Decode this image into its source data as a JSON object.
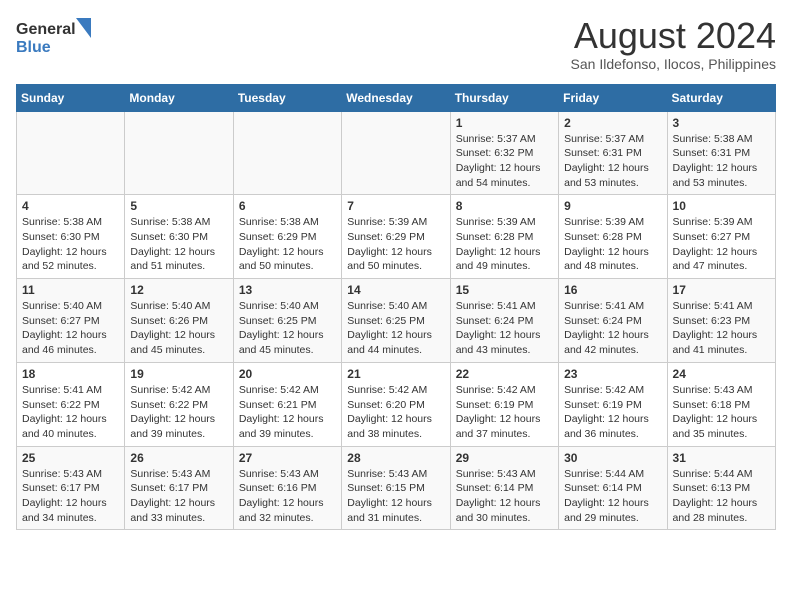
{
  "logo": {
    "text_general": "General",
    "text_blue": "Blue"
  },
  "header": {
    "title": "August 2024",
    "subtitle": "San Ildefonso, Ilocos, Philippines"
  },
  "weekdays": [
    "Sunday",
    "Monday",
    "Tuesday",
    "Wednesday",
    "Thursday",
    "Friday",
    "Saturday"
  ],
  "weeks": [
    [
      {
        "day": "",
        "info": ""
      },
      {
        "day": "",
        "info": ""
      },
      {
        "day": "",
        "info": ""
      },
      {
        "day": "",
        "info": ""
      },
      {
        "day": "1",
        "info": "Sunrise: 5:37 AM\nSunset: 6:32 PM\nDaylight: 12 hours\nand 54 minutes."
      },
      {
        "day": "2",
        "info": "Sunrise: 5:37 AM\nSunset: 6:31 PM\nDaylight: 12 hours\nand 53 minutes."
      },
      {
        "day": "3",
        "info": "Sunrise: 5:38 AM\nSunset: 6:31 PM\nDaylight: 12 hours\nand 53 minutes."
      }
    ],
    [
      {
        "day": "4",
        "info": "Sunrise: 5:38 AM\nSunset: 6:30 PM\nDaylight: 12 hours\nand 52 minutes."
      },
      {
        "day": "5",
        "info": "Sunrise: 5:38 AM\nSunset: 6:30 PM\nDaylight: 12 hours\nand 51 minutes."
      },
      {
        "day": "6",
        "info": "Sunrise: 5:38 AM\nSunset: 6:29 PM\nDaylight: 12 hours\nand 50 minutes."
      },
      {
        "day": "7",
        "info": "Sunrise: 5:39 AM\nSunset: 6:29 PM\nDaylight: 12 hours\nand 50 minutes."
      },
      {
        "day": "8",
        "info": "Sunrise: 5:39 AM\nSunset: 6:28 PM\nDaylight: 12 hours\nand 49 minutes."
      },
      {
        "day": "9",
        "info": "Sunrise: 5:39 AM\nSunset: 6:28 PM\nDaylight: 12 hours\nand 48 minutes."
      },
      {
        "day": "10",
        "info": "Sunrise: 5:39 AM\nSunset: 6:27 PM\nDaylight: 12 hours\nand 47 minutes."
      }
    ],
    [
      {
        "day": "11",
        "info": "Sunrise: 5:40 AM\nSunset: 6:27 PM\nDaylight: 12 hours\nand 46 minutes."
      },
      {
        "day": "12",
        "info": "Sunrise: 5:40 AM\nSunset: 6:26 PM\nDaylight: 12 hours\nand 45 minutes."
      },
      {
        "day": "13",
        "info": "Sunrise: 5:40 AM\nSunset: 6:25 PM\nDaylight: 12 hours\nand 45 minutes."
      },
      {
        "day": "14",
        "info": "Sunrise: 5:40 AM\nSunset: 6:25 PM\nDaylight: 12 hours\nand 44 minutes."
      },
      {
        "day": "15",
        "info": "Sunrise: 5:41 AM\nSunset: 6:24 PM\nDaylight: 12 hours\nand 43 minutes."
      },
      {
        "day": "16",
        "info": "Sunrise: 5:41 AM\nSunset: 6:24 PM\nDaylight: 12 hours\nand 42 minutes."
      },
      {
        "day": "17",
        "info": "Sunrise: 5:41 AM\nSunset: 6:23 PM\nDaylight: 12 hours\nand 41 minutes."
      }
    ],
    [
      {
        "day": "18",
        "info": "Sunrise: 5:41 AM\nSunset: 6:22 PM\nDaylight: 12 hours\nand 40 minutes."
      },
      {
        "day": "19",
        "info": "Sunrise: 5:42 AM\nSunset: 6:22 PM\nDaylight: 12 hours\nand 39 minutes."
      },
      {
        "day": "20",
        "info": "Sunrise: 5:42 AM\nSunset: 6:21 PM\nDaylight: 12 hours\nand 39 minutes."
      },
      {
        "day": "21",
        "info": "Sunrise: 5:42 AM\nSunset: 6:20 PM\nDaylight: 12 hours\nand 38 minutes."
      },
      {
        "day": "22",
        "info": "Sunrise: 5:42 AM\nSunset: 6:19 PM\nDaylight: 12 hours\nand 37 minutes."
      },
      {
        "day": "23",
        "info": "Sunrise: 5:42 AM\nSunset: 6:19 PM\nDaylight: 12 hours\nand 36 minutes."
      },
      {
        "day": "24",
        "info": "Sunrise: 5:43 AM\nSunset: 6:18 PM\nDaylight: 12 hours\nand 35 minutes."
      }
    ],
    [
      {
        "day": "25",
        "info": "Sunrise: 5:43 AM\nSunset: 6:17 PM\nDaylight: 12 hours\nand 34 minutes."
      },
      {
        "day": "26",
        "info": "Sunrise: 5:43 AM\nSunset: 6:17 PM\nDaylight: 12 hours\nand 33 minutes."
      },
      {
        "day": "27",
        "info": "Sunrise: 5:43 AM\nSunset: 6:16 PM\nDaylight: 12 hours\nand 32 minutes."
      },
      {
        "day": "28",
        "info": "Sunrise: 5:43 AM\nSunset: 6:15 PM\nDaylight: 12 hours\nand 31 minutes."
      },
      {
        "day": "29",
        "info": "Sunrise: 5:43 AM\nSunset: 6:14 PM\nDaylight: 12 hours\nand 30 minutes."
      },
      {
        "day": "30",
        "info": "Sunrise: 5:44 AM\nSunset: 6:14 PM\nDaylight: 12 hours\nand 29 minutes."
      },
      {
        "day": "31",
        "info": "Sunrise: 5:44 AM\nSunset: 6:13 PM\nDaylight: 12 hours\nand 28 minutes."
      }
    ]
  ]
}
